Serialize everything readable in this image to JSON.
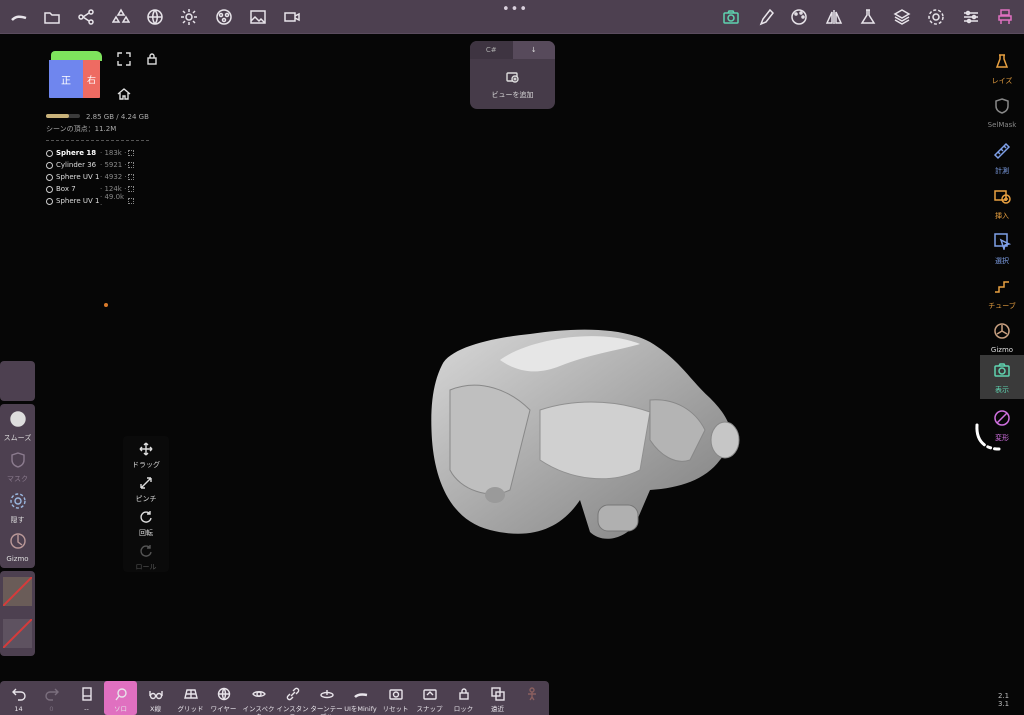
{
  "top_toolbar": {
    "more_dots": "•••",
    "left_icons": [
      "brush-stroke-icon",
      "folder-icon",
      "node-graph-icon",
      "primitives-icon",
      "globe-icon",
      "sun-icon",
      "materials-icon",
      "image-icon",
      "video-camera-icon"
    ],
    "right_icons": [
      "camera-icon",
      "paint-brush-icon",
      "palette-icon",
      "symmetry-icon",
      "flask-icon",
      "layers-icon",
      "settings-gear-icon",
      "sliders-icon",
      "character-icon"
    ],
    "accent_color": "#5fd3b0",
    "pink_color": "#e070c0"
  },
  "views_popup": {
    "tab_1": "C#",
    "tab_2": "↓",
    "add_label": "ビューを追加"
  },
  "nav_cube": {
    "front": "正",
    "side": "右"
  },
  "scene_info": {
    "memory": "2.85 GB / 4.24 GB",
    "memory_fraction": 0.67,
    "vertices": "シーンの頂点：11.2M",
    "objects": [
      {
        "name": "Sphere 18",
        "count": "· 183k ·"
      },
      {
        "name": "Cylinder 36",
        "count": "· 5921 ·"
      },
      {
        "name": "Sphere UV 1",
        "count": "· 4932 ·"
      },
      {
        "name": "Box 7",
        "count": "· 124k ·"
      },
      {
        "name": "Sphere UV 1",
        "count": "· 49.0k ·"
      }
    ]
  },
  "left_panel": {
    "smooth": "スムーズ",
    "mask": "マスク",
    "hide": "隠す",
    "gizmo": "Gizmo"
  },
  "gesture_panel": {
    "drag": "ドラッグ",
    "pinch": "ピンチ",
    "rotate": "回転",
    "roll": "ロール"
  },
  "right_panel": {
    "items": [
      "レイズ",
      "SelMask",
      "計測",
      "挿入",
      "選択",
      "チューブ",
      "Gizmo",
      "表示",
      "変形"
    ],
    "active_index": 7
  },
  "bottom_toolbar": {
    "undo_count": "14",
    "redo_count": "0",
    "doc_label": "--",
    "solo": "ソロ",
    "xray": "X線",
    "grid": "グリッド",
    "wire": "ワイヤー",
    "inspector": "インスペクタ",
    "instance": "インスタンス",
    "turntable": "ターンテーブル",
    "minify": "UIをMinify",
    "reset": "リセット",
    "snap": "スナップ",
    "lock": "ロック",
    "persp": "遠近"
  },
  "version": {
    "line1": "2.1",
    "line2": "3.1"
  }
}
